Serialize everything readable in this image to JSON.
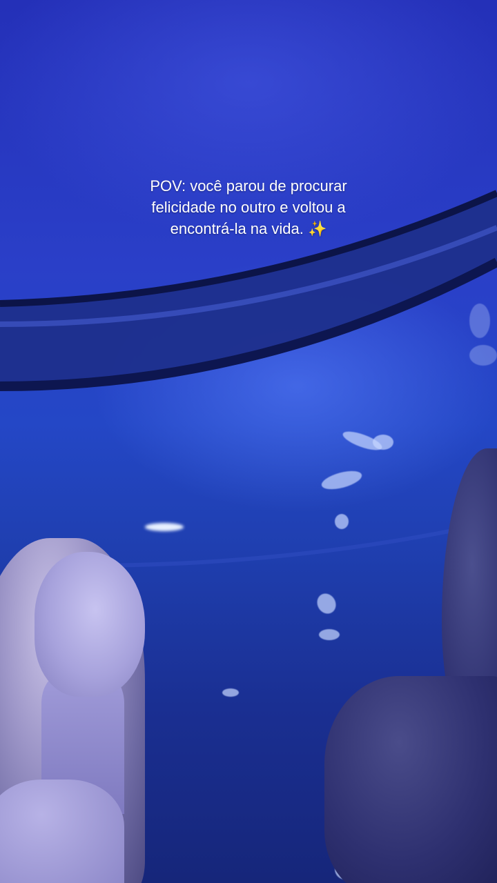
{
  "caption": {
    "text": "POV: você parou de procurar\nfelicidade no outro e voltou a\nencontrá-la na vida. ✨"
  },
  "scene": {
    "description_tags": [
      "aquarium-tunnel",
      "woman-looking-up",
      "fish",
      "rock"
    ],
    "colors": {
      "water": "#2447c6",
      "tunnel_frame": "#14205e",
      "caption_text": "#ffffff"
    }
  }
}
